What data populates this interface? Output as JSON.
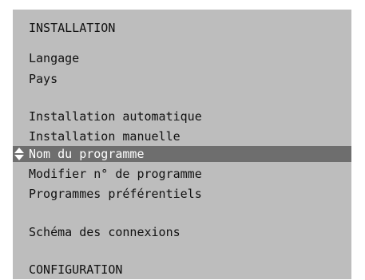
{
  "menu": {
    "title": "INSTALLATION",
    "language": "Langage",
    "country": "Pays",
    "auto_install": "Installation automatique",
    "manual_install": "Installation manuelle",
    "program_name": "Nom du programme",
    "modify_program_number": "Modifier n° de programme",
    "preferred_programs": "Programmes préférentiels",
    "connection_diagram": "Schéma des connexions",
    "configuration": "CONFIGURATION",
    "selected_item": "Nom du programme"
  },
  "colors": {
    "panel_background": "#bdbdbd",
    "selected_background": "#6e6e6e",
    "selected_text": "#ffffff",
    "text": "#111111"
  }
}
